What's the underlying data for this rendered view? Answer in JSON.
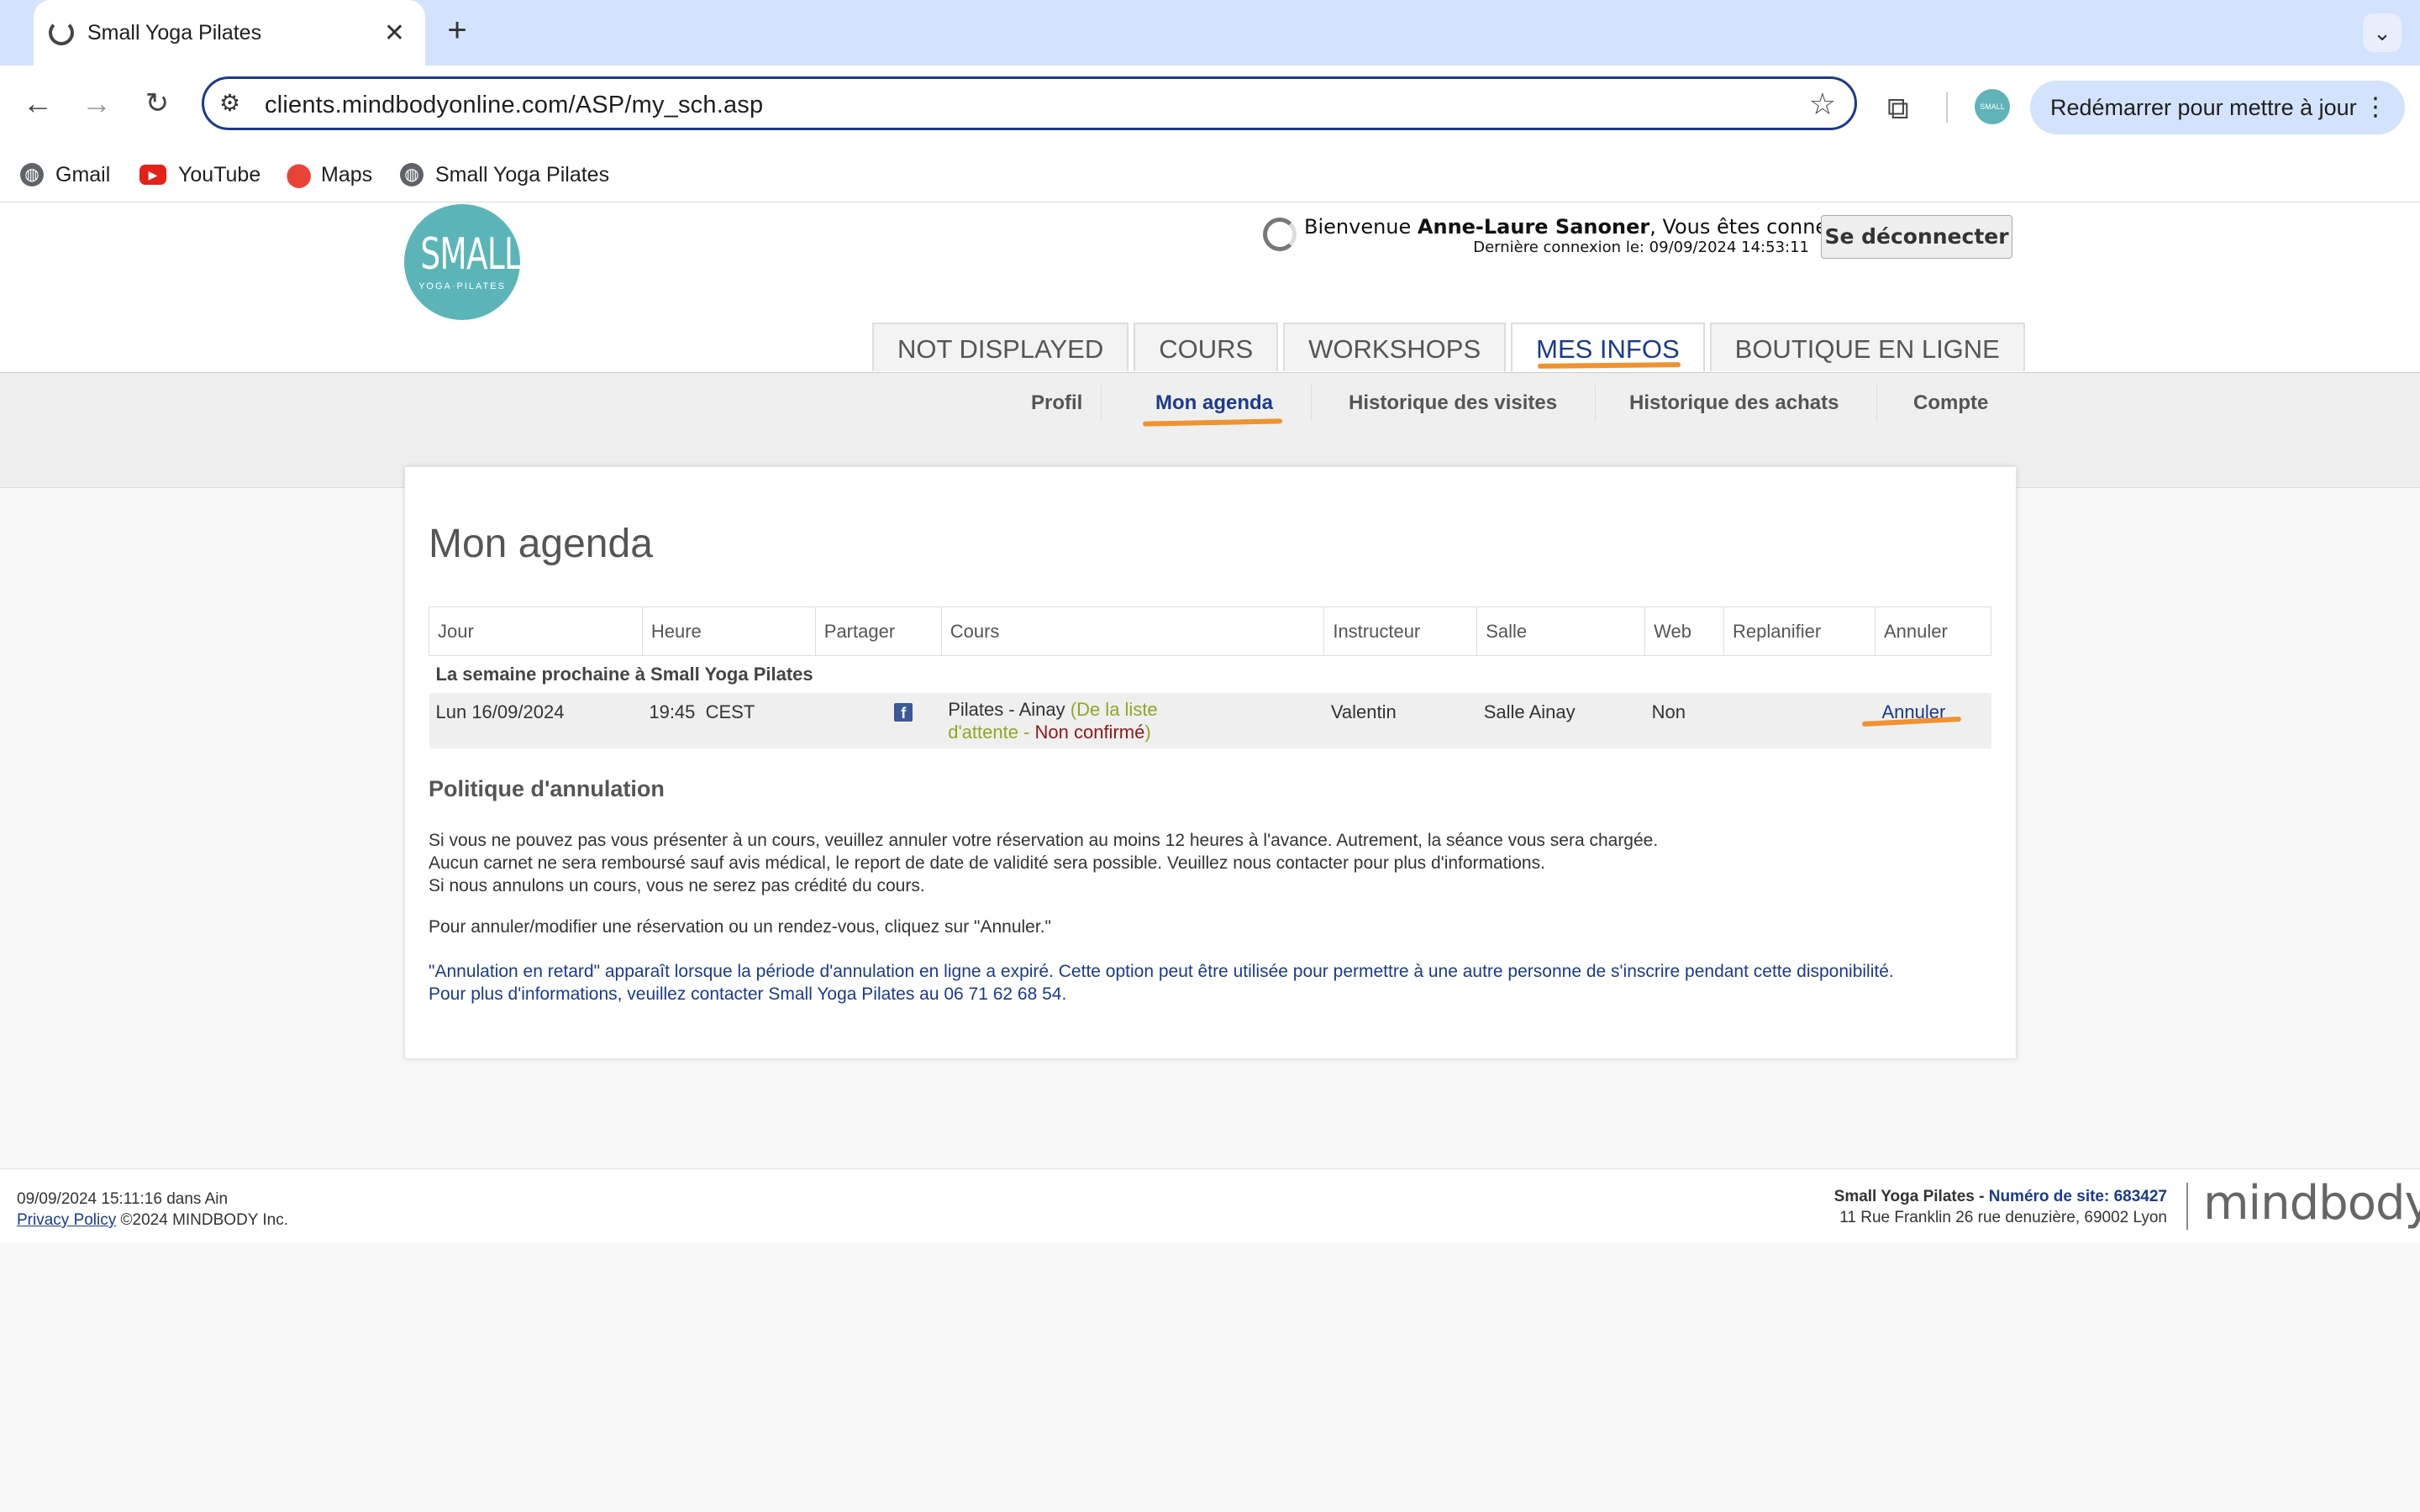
{
  "browser": {
    "tab_title": "Small Yoga Pilates",
    "url": "clients.mindbodyonline.com/ASP/my_sch.asp",
    "update_button": "Redémarrer pour mettre à jour",
    "profile_text": "SMALL",
    "bookmarks": [
      {
        "label": "Gmail",
        "icon": "globe-icon"
      },
      {
        "label": "YouTube",
        "icon": "youtube-icon"
      },
      {
        "label": "Maps",
        "icon": "maps-pin-icon"
      },
      {
        "label": "Small Yoga Pilates",
        "icon": "globe-icon"
      }
    ]
  },
  "header": {
    "logo_main": "SMALL",
    "logo_sub": "YOGA·PILATES",
    "welcome_prefix": "Bienvenue ",
    "user_name": "Anne-Laure Sanoner",
    "welcome_suffix": ", Vous êtes connecté(e)",
    "last_login": "Dernière connexion le: 09/09/2024 14:53:11",
    "logout_label": "Se déconnecter",
    "main_tabs": [
      {
        "label": "NOT DISPLAYED",
        "active": false
      },
      {
        "label": "COURS",
        "active": false
      },
      {
        "label": "WORKSHOPS",
        "active": false
      },
      {
        "label": "MES INFOS",
        "active": true
      },
      {
        "label": "BOUTIQUE EN LIGNE",
        "active": false
      }
    ],
    "sub_tabs": [
      {
        "label": "Profil",
        "active": false
      },
      {
        "label": "Mon agenda",
        "active": true
      },
      {
        "label": "Historique des visites",
        "active": false
      },
      {
        "label": "Historique des achats",
        "active": false
      },
      {
        "label": "Compte",
        "active": false
      }
    ],
    "accent_color": "#1a3a8c",
    "highlight_color": "#f0922f"
  },
  "main": {
    "title": "Mon agenda",
    "table": {
      "columns": [
        "Jour",
        "Heure",
        "Partager",
        "Cours",
        "Instructeur",
        "Salle",
        "Web",
        "Replanifier",
        "Annuler"
      ],
      "group_label": "La semaine prochaine à Small Yoga Pilates",
      "rows": [
        {
          "jour": "Lun 16/09/2024",
          "heure": "19:45  CEST",
          "share_icon": "facebook-icon",
          "cours_name": "Pilates - Ainay ",
          "cours_waitlist_line1": "(De la liste",
          "cours_waitlist_line2": "d'attente - ",
          "cours_status": "Non confirmé",
          "cours_close": ")",
          "instructeur": "Valentin",
          "salle": "Salle Ainay",
          "web": "Non",
          "replanifier": "",
          "annuler": "Annuler"
        }
      ]
    },
    "policy": {
      "title": "Politique d'annulation",
      "line1": "Si vous ne pouvez pas vous présenter à un cours, veuillez annuler votre réservation au moins 12 heures à l'avance. Autrement, la séance vous sera chargée.",
      "line2": "Aucun carnet ne sera remboursé sauf avis médical, le report de date de validité sera possible. Veuillez nous contacter pour plus d'informations.",
      "line3": "Si nous annulons un cours, vous ne serez pas crédité du cours.",
      "how_to": "Pour annuler/modifier une réservation ou un rendez-vous, cliquez sur \"Annuler.\"",
      "late_line1": "\"Annulation en retard\" apparaît lorsque la période d'annulation en ligne a expiré. Cette option peut être utilisée pour permettre à une autre personne de s'inscrire pendant cette disponibilité.",
      "late_line2": "Pour plus d'informations, veuillez contacter Small Yoga Pilates au 06 71 62 68 54."
    }
  },
  "footer": {
    "timestamp": "09/09/2024 15:11:16 dans Ain",
    "privacy_link": "Privacy Policy",
    "copyright": " ©2024 MINDBODY Inc.",
    "studio_name": "Small Yoga Pilates - ",
    "site_number": "Numéro de site: 683427",
    "address": "11 Rue Franklin 26 rue denuzière, 69002 Lyon",
    "brand": "mindbody"
  }
}
